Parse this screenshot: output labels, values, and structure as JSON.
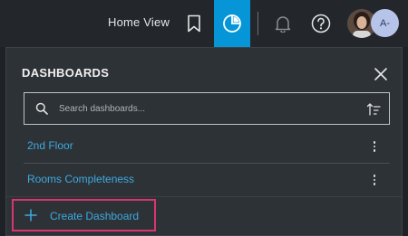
{
  "topbar": {
    "home_view_label": "Home View",
    "avatar_initials": "A-"
  },
  "panel": {
    "title": "DASHBOARDS",
    "search_placeholder": "Search dashboards...",
    "items": [
      {
        "label": "2nd Floor"
      },
      {
        "label": "Rooms Completeness"
      }
    ],
    "create_label": "Create Dashboard"
  },
  "colors": {
    "accent": "#0696d7",
    "link": "#3fa9e0",
    "highlight": "#d9346f"
  }
}
